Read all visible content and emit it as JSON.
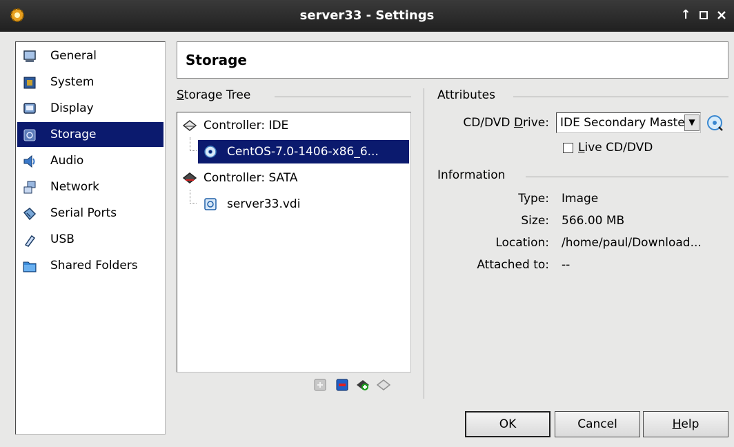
{
  "window": {
    "title": "server33 - Settings"
  },
  "sidebar": {
    "items": [
      {
        "label": "General",
        "icon": "general-monitor-icon"
      },
      {
        "label": "System",
        "icon": "system-chip-icon"
      },
      {
        "label": "Display",
        "icon": "display-monitor-icon"
      },
      {
        "label": "Storage",
        "icon": "storage-disk-icon",
        "selected": true
      },
      {
        "label": "Audio",
        "icon": "audio-speaker-icon"
      },
      {
        "label": "Network",
        "icon": "network-icon"
      },
      {
        "label": "Serial Ports",
        "icon": "serial-port-icon"
      },
      {
        "label": "USB",
        "icon": "usb-icon"
      },
      {
        "label": "Shared Folders",
        "icon": "shared-folder-icon"
      }
    ]
  },
  "page": {
    "title": "Storage"
  },
  "storage_tree": {
    "legend_mnemonic": "S",
    "legend_rest": "torage Tree",
    "rows": [
      {
        "label": "Controller: IDE",
        "icon": "ide-controller-icon"
      },
      {
        "label": "CentOS-7.0-1406-x86_6...",
        "icon": "optical-disc-icon",
        "selected": true
      },
      {
        "label": "Controller: SATA",
        "icon": "sata-controller-icon"
      },
      {
        "label": "server33.vdi",
        "icon": "hard-disk-icon"
      }
    ],
    "toolbar": [
      "add-attachment-icon",
      "remove-attachment-icon",
      "add-controller-icon",
      "remove-controller-icon"
    ]
  },
  "attributes": {
    "legend": "Attributes",
    "cd_drive_pre": "CD/DVD ",
    "cd_drive_mnemonic": "D",
    "cd_drive_post": "rive:",
    "cd_drive_value": "IDE Secondary Master",
    "live_cd_mnemonic": "L",
    "live_cd_rest": "ive CD/DVD",
    "live_cd_checked": false
  },
  "information": {
    "legend": "Information",
    "rows": [
      {
        "label": "Type:",
        "value": "Image"
      },
      {
        "label": "Size:",
        "value": "566.00 MB"
      },
      {
        "label": "Location:",
        "value": "/home/paul/Download..."
      },
      {
        "label": "Attached to:",
        "value": "--"
      }
    ]
  },
  "buttons": {
    "ok": "OK",
    "cancel": "Cancel",
    "help_mnemonic": "H",
    "help_rest": "elp"
  },
  "colors": {
    "selection": "#0b1a6e",
    "titlebar": "#2a2a2a"
  }
}
